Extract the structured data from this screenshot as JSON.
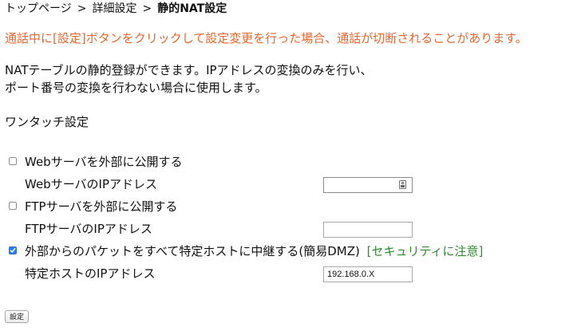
{
  "breadcrumb": {
    "items": [
      "トップページ",
      "詳細設定",
      "静的NAT設定"
    ],
    "separator": ">"
  },
  "warning": {
    "text": "通話中に[設定]ボタンをクリックして設定変更を行った場合、通話が切断されることがあります。",
    "color": "#e8672c"
  },
  "description": {
    "line1": "NATテーブルの静的登録ができます。IPアドレスの変換のみを行い、",
    "line2": "ポート番号の変換を行わない場合に使用します。"
  },
  "one_touch": {
    "title": "ワンタッチ設定",
    "web": {
      "checkbox_label": "Webサーバを外部に公開する",
      "checked": false,
      "ip_label": "WebサーバのIPアドレス",
      "ip_value": ""
    },
    "ftp": {
      "checkbox_label": "FTPサーバを外部に公開する",
      "checked": false,
      "ip_label": "FTPサーバのIPアドレス",
      "ip_value": ""
    },
    "dmz": {
      "checkbox_label": "外部からのパケットをすべて特定ホストに中継する(簡易DMZ)",
      "checked": true,
      "security_note": "[セキュリティに注意]",
      "ip_label": "特定ホストのIPアドレス",
      "ip_value": "192.168.0.X"
    }
  },
  "submit_label": "設定",
  "colors": {
    "warning": "#e8672c",
    "security_note": "#2f8a2f",
    "checkbox_checked": "#2f7cf6"
  },
  "icons": {
    "autofill": "contact-card-icon",
    "checkmark": "checkmark-icon"
  }
}
